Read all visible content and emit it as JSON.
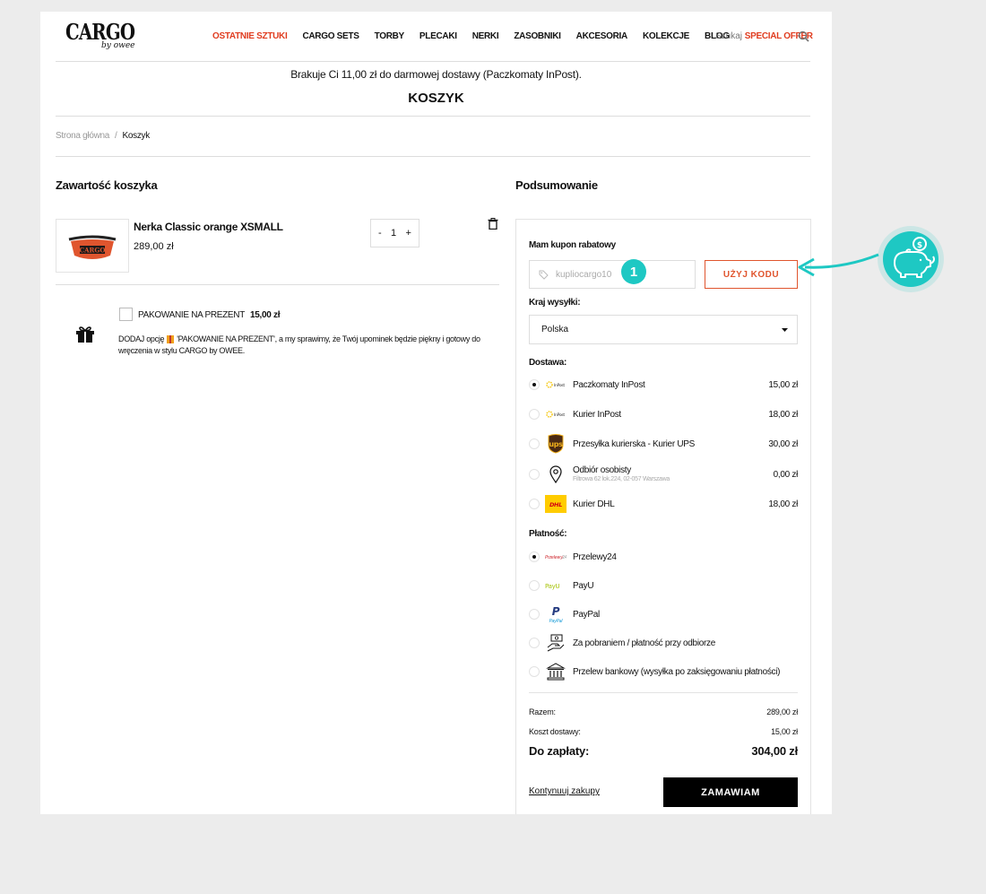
{
  "header": {
    "logo": "CARGO",
    "logo_sub": "by owee",
    "nav": [
      "OSTATNIE SZTUKI",
      "CARGO SETS",
      "TORBY",
      "PLECAKI",
      "NERKI",
      "ZASOBNIKI",
      "AKCESORIA",
      "KOLEKCJE",
      "BLOG",
      "SPECIAL OFFER"
    ],
    "search_label": "Szukaj"
  },
  "shipping_note": "Brakuje Ci 11,00 zł do darmowej dostawy (Paczkomaty InPost).",
  "page_title": "KOSZYK",
  "breadcrumb": {
    "home": "Strona główna",
    "sep": "/",
    "current": "Koszyk"
  },
  "cart": {
    "heading": "Zawartość koszyka",
    "item": {
      "name": "Nerka Classic orange XSMALL",
      "price": "289,00 zł",
      "qty_minus": "-",
      "qty": "1",
      "qty_plus": "+",
      "thumb_text": "CARGO"
    },
    "gift": {
      "label": "PAKOWANIE NA PREZENT",
      "price": "15,00 zł",
      "desc_a": "DODAJ opcję",
      "desc_b": "'PAKOWANIE NA PREZENT', a my sprawimy, że Twój upominek będzie piękny i gotowy do wręczenia w stylu CARGO by OWEE."
    }
  },
  "summary": {
    "heading": "Podsumowanie",
    "coupon_label": "Mam kupon rabatowy",
    "coupon_placeholder": "kupliocargo10",
    "coupon_button": "UŻYJ KODU",
    "country_label": "Kraj wysyłki:",
    "country_value": "Polska",
    "delivery_label": "Dostawa:",
    "delivery": [
      {
        "name": "Paczkomaty InPost",
        "price": "15,00 zł",
        "icon": "inpost-icon",
        "selected": true
      },
      {
        "name": "Kurier InPost",
        "price": "18,00 zł",
        "icon": "inpost-icon",
        "selected": false
      },
      {
        "name": "Przesyłka kurierska - Kurier UPS",
        "price": "30,00 zł",
        "icon": "ups-icon",
        "selected": false
      },
      {
        "name": "Odbiór osobisty",
        "sub": "Filtrowa 62 lok.224, 02-057 Warszawa",
        "price": "0,00 zł",
        "icon": "location-pin-icon",
        "selected": false
      },
      {
        "name": "Kurier DHL",
        "price": "18,00 zł",
        "icon": "dhl-icon",
        "selected": false
      }
    ],
    "payment_label": "Płatność:",
    "payment": [
      {
        "name": "Przelewy24",
        "icon": "przelewy24-icon",
        "selected": true
      },
      {
        "name": "PayU",
        "icon": "payu-icon",
        "selected": false
      },
      {
        "name": "PayPal",
        "icon": "paypal-icon",
        "selected": false
      },
      {
        "name": "Za pobraniem / płatność przy odbiorze",
        "icon": "cash-hand-icon",
        "selected": false
      },
      {
        "name": "Przelew bankowy (wysyłka po zaksięgowaniu płatności)",
        "icon": "bank-icon",
        "selected": false
      }
    ],
    "subtotal_label": "Razem:",
    "subtotal": "289,00 zł",
    "shipping_cost_label": "Koszt dostawy:",
    "shipping_cost": "15,00 zł",
    "total_label": "Do zapłaty:",
    "total": "304,00 zł",
    "continue_label": "Kontynuuj zakupy",
    "order_button": "ZAMAWIAM"
  },
  "annotation": {
    "step": "1",
    "accent": "#1ec8c3"
  },
  "colors": {
    "accent_red": "#e03c1f",
    "black": "#000000",
    "teal": "#1ec8c3"
  }
}
